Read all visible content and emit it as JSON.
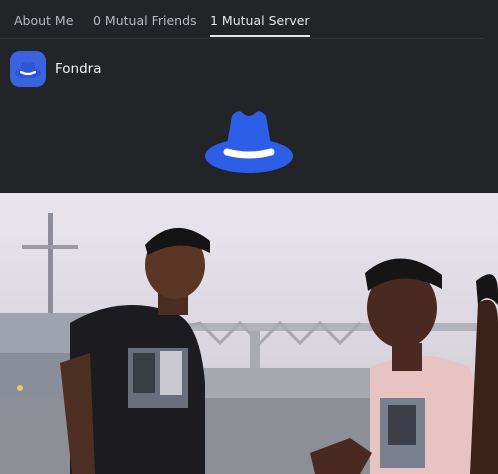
{
  "tabs": {
    "about": "About Me",
    "friends": "0 Mutual Friends",
    "servers": "1 Mutual Server"
  },
  "server": {
    "name": "Fondra",
    "icon": "hat-icon"
  },
  "banner_icon": "hat-icon",
  "media": {
    "icon": "gif-image"
  },
  "colors": {
    "background": "#232428",
    "accent_blue": "#3a63e0",
    "tab_text": "#b5bac1",
    "tab_active": "#e6e7ea"
  }
}
